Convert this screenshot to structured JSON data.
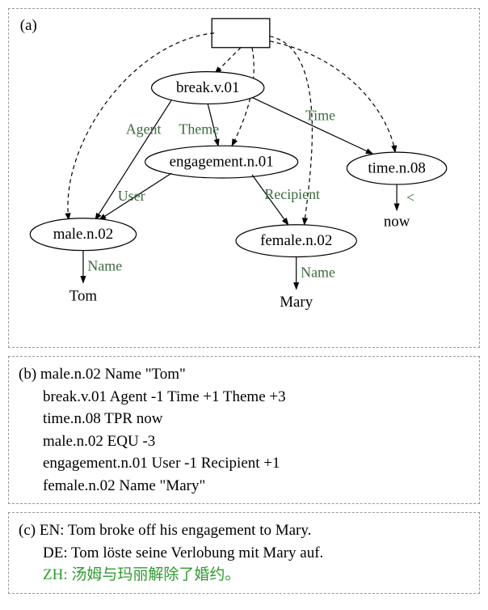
{
  "panel_a": {
    "label": "(a)",
    "root": "",
    "nodes": {
      "break": "break.v.01",
      "engagement": "engagement.n.01",
      "time": "time.n.08",
      "male": "male.n.02",
      "female": "female.n.02"
    },
    "edges": {
      "agent": "Agent",
      "theme": "Theme",
      "time": "Time",
      "user": "User",
      "recipient": "Recipient",
      "name_male": "Name",
      "name_female": "Name",
      "lt": "<"
    },
    "leaves": {
      "tom": "Tom",
      "mary": "Mary",
      "now": "now"
    }
  },
  "panel_b": {
    "label": "(b)",
    "lines": [
      "male.n.02 Name \"Tom\"",
      "break.v.01 Agent -1 Time +1 Theme +3",
      "time.n.08 TPR now",
      "male.n.02 EQU -3",
      "engagement.n.01 User -1 Recipient +1",
      "female.n.02 Name \"Mary\""
    ]
  },
  "panel_c": {
    "label": "(c)",
    "lines": [
      "EN: Tom broke off his engagement to Mary.",
      "DE: Tom löste seine Verlobung mit Mary auf.",
      "ZH: 汤姆与玛丽解除了婚约。"
    ]
  }
}
